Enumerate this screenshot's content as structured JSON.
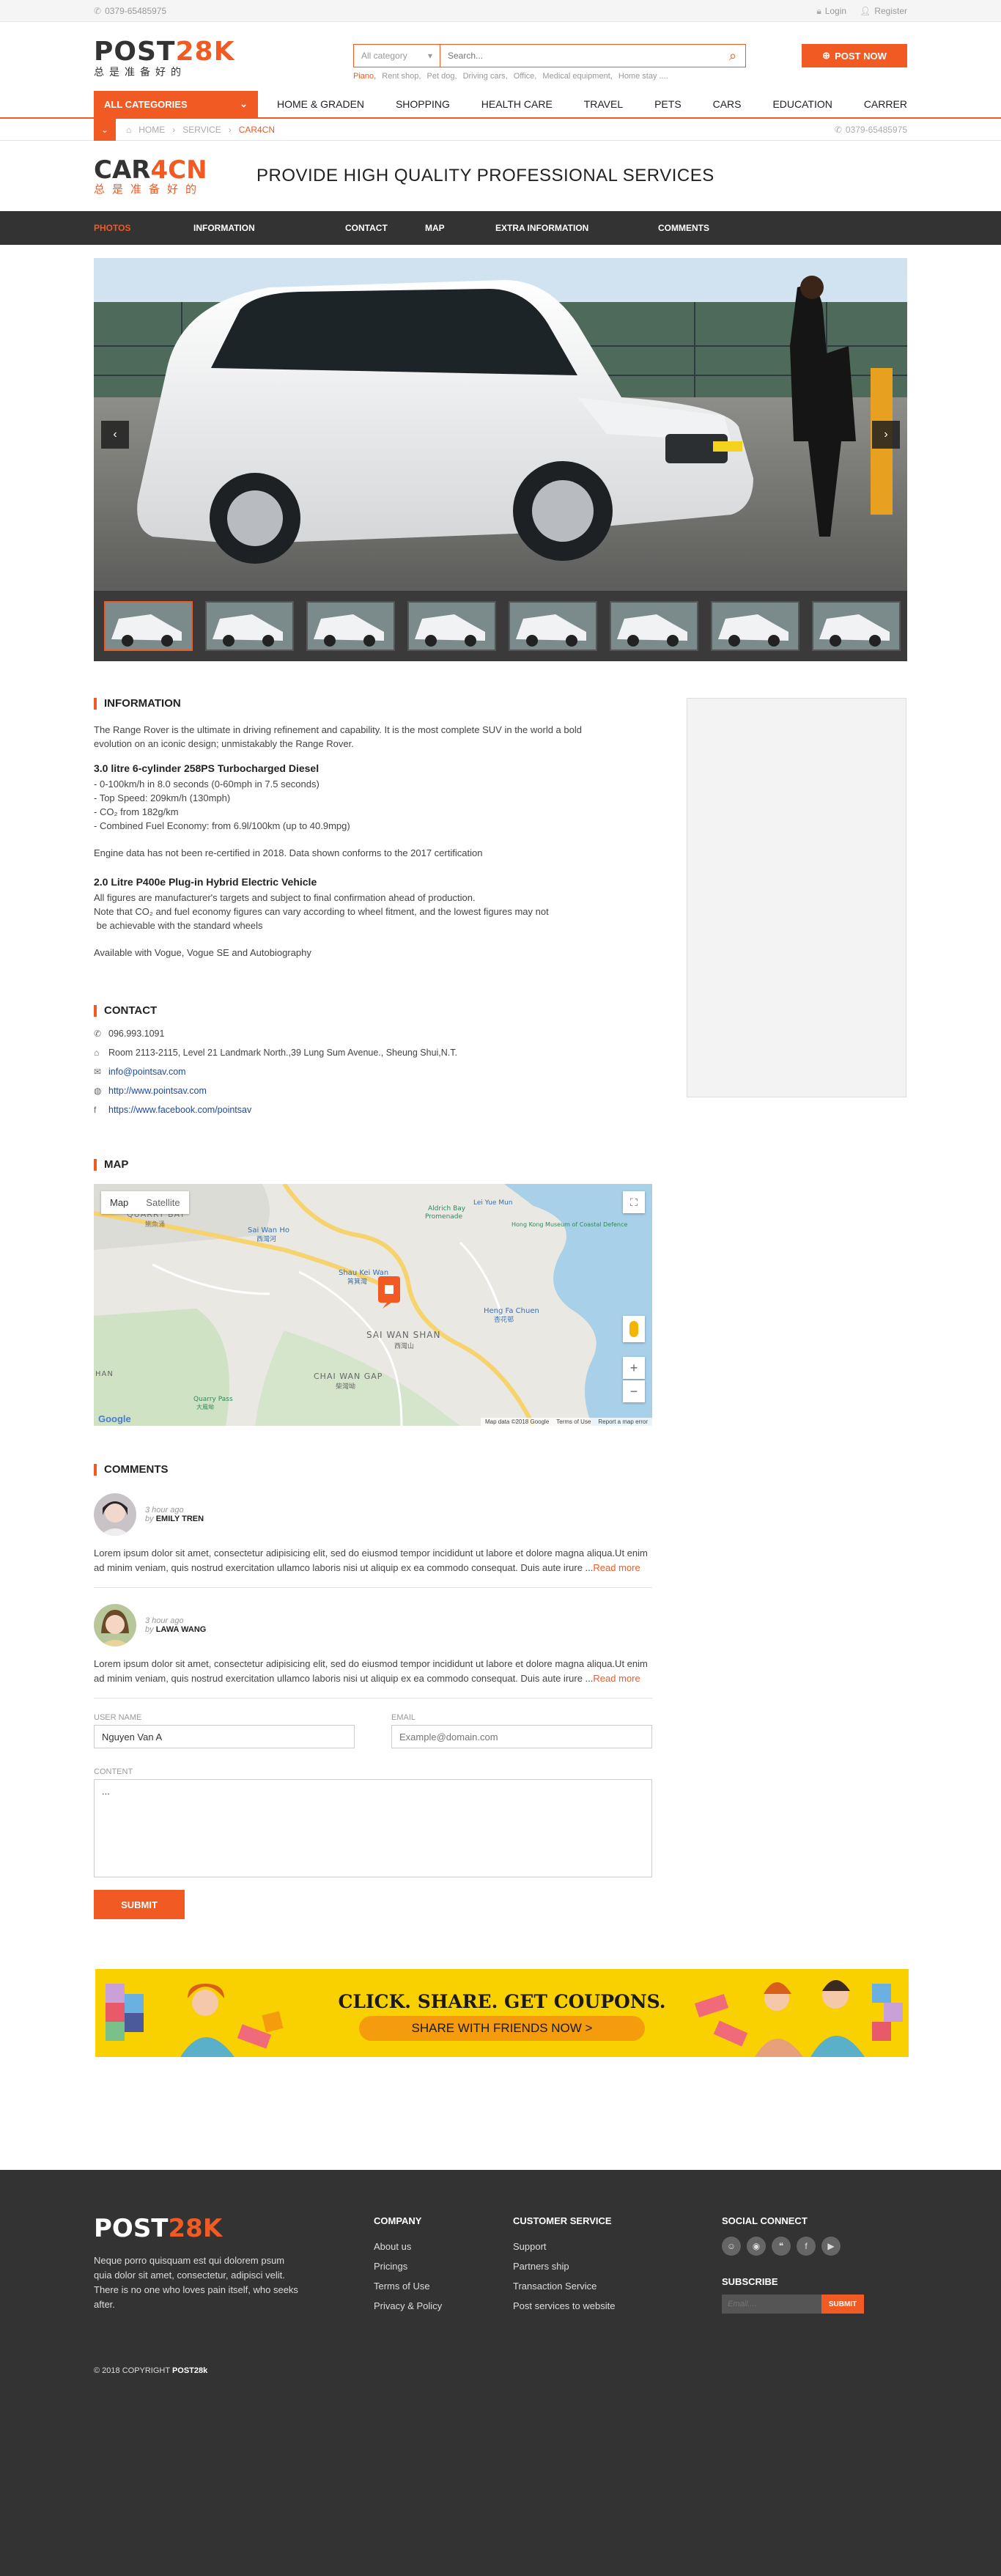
{
  "topbar": {
    "phone": "0379-65485975",
    "login": "Login",
    "register": "Register"
  },
  "header": {
    "logo_a": "POST",
    "logo_b": "28K",
    "logo_tag": "总是准备好的",
    "category_select": "All category",
    "search_placeholder": "Search...",
    "hot_searches": [
      "Piano,",
      "Rent shop,",
      "Pet dog,",
      "Driving cars,",
      "Office,",
      "Medical equipment,",
      "Home stay ...."
    ],
    "post_now": "POST NOW"
  },
  "nav": {
    "all_categories": "ALL CATEGORIES",
    "items": [
      "HOME & GRADEN",
      "SHOPPING",
      "HEALTH CARE",
      "TRAVEL",
      "PETS",
      "CARS",
      "EDUCATION",
      "CARRER"
    ]
  },
  "breadcrumb": {
    "home": "HOME",
    "service": "SERVICE",
    "current": "CAR4CN",
    "phone": "0379-65485975"
  },
  "company": {
    "logo_a": "CAR",
    "logo_b": "4CN",
    "logo_tag": "总是准备好的",
    "title": "PROVIDE HIGH QUALITY PROFESSIONAL SERVICES"
  },
  "tabs": [
    "PHOTOS",
    "INFORMATION",
    "CONTACT",
    "MAP",
    "EXTRA INFORMATION",
    "COMMENTS"
  ],
  "information": {
    "title": "INFORMATION",
    "intro": "The Range Rover is the ultimate in driving refinement and capability. It is the most complete SUV in the world a bold evolution on an iconic design; unmistakably the Range Rover.",
    "engine1_title": "3.0 litre 6-cylinder 258PS Turbocharged Diesel",
    "engine1_lines": [
      "- 0-100km/h in 8.0 seconds (0-60mph in 7.5 seconds)",
      "- Top Speed: 209km/h (130mph)",
      "- CO₂ from 182g/km",
      "- Combined Fuel Economy: from 6.9l/100km (up to 40.9mpg)"
    ],
    "engine_note": "Engine data has not been re-certified in 2018. Data shown conforms to the 2017 certification",
    "engine2_title": "2.0 Litre P400e Plug-in Hybrid Electric Vehicle",
    "engine2_lines": [
      "All figures are manufacturer's targets and subject to final confirmation ahead of production.",
      "Note that CO₂ and fuel economy figures can vary according to wheel fitment, and the lowest figures may not",
      " be achievable with the standard wheels"
    ],
    "availability": "Available with Vogue, Vogue SE and Autobiography"
  },
  "contact": {
    "title": "CONTACT",
    "phone": "096.993.1091",
    "address": "Room 2113-2115, Level 21 Landmark North.,39 Lung Sum Avenue., Sheung Shui,N.T.",
    "email": "info@pointsav.com",
    "website": "http://www.pointsav.com",
    "facebook": "https://www.facebook.com/pointsav"
  },
  "map": {
    "title": "MAP",
    "btn_map": "Map",
    "btn_satellite": "Satellite",
    "labels": {
      "quarry_bay": "QUARRY BAY",
      "quarry_bay_cn": "鰂魚涌",
      "sai_wan_ho": "Sai Wan Ho",
      "sai_wan_ho_cn": "西灣河",
      "aldrich_bay": "Aldrich Bay",
      "promenade": "Promenade",
      "lei_yue_mun": "Lei Yue Mun",
      "museum": "Hong Kong Museum of Coastal Defence",
      "shau_kei_wan": "Shau Kei Wan",
      "shau_kei_wan_cn": "筲箕灣",
      "heng_fa_chuen": "Heng Fa Chuen",
      "heng_fa_chuen_cn": "杏花邨",
      "sai_wan_shan": "SAI WAN SHAN",
      "sai_wan_shan_cn": "西灣山",
      "chai_wan_gap": "CHAI WAN GAP",
      "chai_wan_gap_cn": "柴灣坳",
      "quarry_pass": "Quarry Pass",
      "quarry_pass_cn": "大風坳",
      "shan": "HAN"
    },
    "footer": {
      "data": "Map data ©2018 Google",
      "terms": "Terms of Use",
      "report": "Report a map error",
      "google": "Google"
    }
  },
  "comments": {
    "title": "COMMENTS",
    "items": [
      {
        "time": "3 hour ago",
        "by": "by",
        "author": "EMILY TREN",
        "text": "Lorem ipsum dolor sit amet, consectetur adipisicing elit, sed do eiusmod tempor incididunt ut labore et dolore magna aliqua.Ut enim ad minim veniam, quis nostrud exercitation ullamco laboris nisi ut aliquip ex ea commodo consequat. Duis aute irure ...",
        "more": "Read more"
      },
      {
        "time": "3 hour ago",
        "by": "by",
        "author": "LAWA WANG",
        "text": "Lorem ipsum dolor sit amet, consectetur adipisicing elit, sed do eiusmod tempor incididunt ut labore et dolore magna aliqua.Ut enim ad minim veniam, quis nostrud exercitation ullamco laboris nisi ut aliquip ex ea commodo consequat. Duis aute irure ...",
        "more": "Read more"
      }
    ],
    "form": {
      "username_label": "USER NAME",
      "username_value": "Nguyen Van A",
      "email_label": "EMAIL",
      "email_placeholder": "Example@domain.com",
      "content_label": "CONTENT",
      "content_value": "...",
      "submit": "SUBMIT"
    }
  },
  "banner": {
    "title": "CLICK. SHARE. GET COUPONS.",
    "button": "SHARE WITH FRIENDS NOW  >"
  },
  "footer": {
    "logo_a": "POST",
    "logo_b": "28K",
    "description": "Neque porro quisquam est qui dolorem psum quia dolor sit amet, consectetur, adipisci velit. There is no one who loves pain itself, who seeks after.",
    "company_title": "COMPANY",
    "company_links": [
      "About us",
      "Pricings",
      "Terms of Use",
      "Privacy & Policy"
    ],
    "service_title": "CUSTOMER SERVICE",
    "service_links": [
      "Support",
      "Partners ship",
      "Transaction Service",
      "Post services to website"
    ],
    "social_title": "SOCIAL CONNECT",
    "subscribe_title": "SUBSCRIBE",
    "email_placeholder": "Email....",
    "subscribe_btn": "SUBMIT",
    "copyright_a": "© 2018 COPYRIGHT",
    "copyright_b": "POST28k"
  }
}
